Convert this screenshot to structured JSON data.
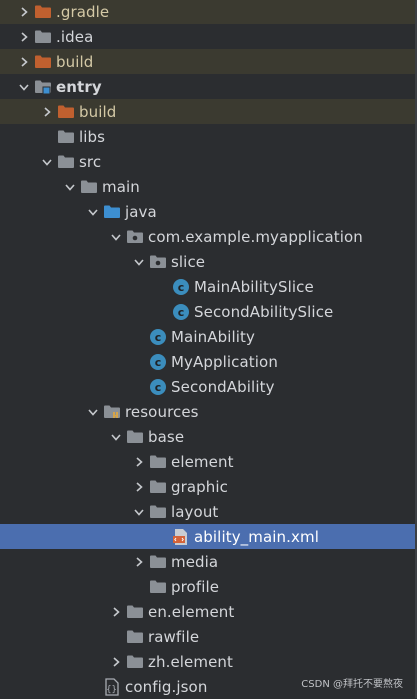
{
  "tree": {
    "rows": [
      {
        "label": ".gradle",
        "depth": 0,
        "arrow": "right",
        "icon": "folder-orange",
        "excluded": true,
        "icon_name": "folder-icon"
      },
      {
        "label": ".idea",
        "depth": 0,
        "arrow": "right",
        "icon": "folder-gray",
        "icon_name": "folder-icon"
      },
      {
        "label": "build",
        "depth": 0,
        "arrow": "right",
        "icon": "folder-orange",
        "excluded": true,
        "icon_name": "folder-icon"
      },
      {
        "label": "entry",
        "depth": 0,
        "arrow": "down",
        "icon": "module",
        "bold": true,
        "icon_name": "module-folder-icon"
      },
      {
        "label": "build",
        "depth": 1,
        "arrow": "right",
        "icon": "folder-orange",
        "excluded": true,
        "icon_name": "folder-icon"
      },
      {
        "label": "libs",
        "depth": 1,
        "arrow": "none",
        "icon": "folder-gray",
        "icon_name": "folder-icon"
      },
      {
        "label": "src",
        "depth": 1,
        "arrow": "down",
        "icon": "folder-gray",
        "icon_name": "folder-icon"
      },
      {
        "label": "main",
        "depth": 2,
        "arrow": "down",
        "icon": "folder-gray",
        "icon_name": "folder-icon"
      },
      {
        "label": "java",
        "depth": 3,
        "arrow": "down",
        "icon": "folder-blue",
        "icon_name": "source-folder-icon"
      },
      {
        "label": "com.example.myapplication",
        "depth": 4,
        "arrow": "down",
        "icon": "package",
        "icon_name": "package-icon"
      },
      {
        "label": "slice",
        "depth": 5,
        "arrow": "down",
        "icon": "package",
        "icon_name": "package-icon"
      },
      {
        "label": "MainAbilitySlice",
        "depth": 6,
        "arrow": "none",
        "icon": "class",
        "icon_name": "class-icon"
      },
      {
        "label": "SecondAbilitySlice",
        "depth": 6,
        "arrow": "none",
        "icon": "class",
        "icon_name": "class-icon"
      },
      {
        "label": "MainAbility",
        "depth": 5,
        "arrow": "none",
        "icon": "class",
        "icon_name": "class-icon"
      },
      {
        "label": "MyApplication",
        "depth": 5,
        "arrow": "none",
        "icon": "class",
        "icon_name": "class-icon"
      },
      {
        "label": "SecondAbility",
        "depth": 5,
        "arrow": "none",
        "icon": "class",
        "icon_name": "class-icon"
      },
      {
        "label": "resources",
        "depth": 3,
        "arrow": "down",
        "icon": "resources",
        "icon_name": "resources-folder-icon"
      },
      {
        "label": "base",
        "depth": 4,
        "arrow": "down",
        "icon": "folder-gray",
        "icon_name": "folder-icon"
      },
      {
        "label": "element",
        "depth": 5,
        "arrow": "right",
        "icon": "folder-gray",
        "icon_name": "folder-icon"
      },
      {
        "label": "graphic",
        "depth": 5,
        "arrow": "right",
        "icon": "folder-gray",
        "icon_name": "folder-icon"
      },
      {
        "label": "layout",
        "depth": 5,
        "arrow": "down",
        "icon": "folder-gray",
        "icon_name": "folder-icon"
      },
      {
        "label": "ability_main.xml",
        "depth": 6,
        "arrow": "none",
        "icon": "xml",
        "selected": true,
        "icon_name": "xml-file-icon"
      },
      {
        "label": "media",
        "depth": 5,
        "arrow": "right",
        "icon": "folder-gray",
        "icon_name": "folder-icon"
      },
      {
        "label": "profile",
        "depth": 5,
        "arrow": "none",
        "icon": "folder-gray",
        "icon_name": "folder-icon"
      },
      {
        "label": "en.element",
        "depth": 4,
        "arrow": "right",
        "icon": "folder-gray",
        "icon_name": "folder-icon"
      },
      {
        "label": "rawfile",
        "depth": 4,
        "arrow": "none",
        "icon": "folder-gray",
        "icon_name": "folder-icon"
      },
      {
        "label": "zh.element",
        "depth": 4,
        "arrow": "right",
        "icon": "folder-gray",
        "icon_name": "folder-icon"
      },
      {
        "label": "config.json",
        "depth": 3,
        "arrow": "none",
        "icon": "json",
        "icon_name": "json-file-icon"
      }
    ]
  },
  "watermark": "CSDN @拜托不要熬夜",
  "colors": {
    "background": "#2b2d30",
    "selected": "#4b6eaf",
    "excluded_row": "#3b3a30",
    "folder_orange": "#c0602f",
    "folder_gray": "#8b9096",
    "folder_blue": "#3d8fd1",
    "class_icon": "#3b8dbd"
  }
}
